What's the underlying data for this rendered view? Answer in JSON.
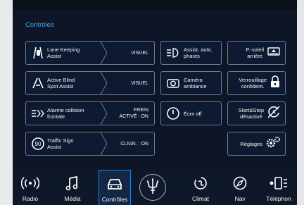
{
  "section": {
    "title": "Contrôles"
  },
  "left_tiles": [
    {
      "label": "Lane Keeping\nAssist",
      "value": "VISUEL",
      "icon": "lane-keeping-icon"
    },
    {
      "label": "Active Blind\nSpot Assist",
      "value": "VISUEL",
      "icon": "blind-spot-icon"
    },
    {
      "label": "Alarme collision\nfrontale",
      "value": "FREIN\nACTIVÉ : ON",
      "icon": "collision-alarm-icon"
    },
    {
      "label": "Traffic Sign\nAssist",
      "value": "CLIGN. : ON",
      "icon": "traffic-sign-icon"
    }
  ],
  "mid_tiles": [
    {
      "label": "Assist. auto.\nphares",
      "icon": "auto-headlight-icon"
    },
    {
      "label": "Caméra\nambiance",
      "icon": "camera-icon"
    },
    {
      "label": "Écrn off",
      "icon": "power-icon"
    }
  ],
  "right_tiles": [
    {
      "label": "P.-soleil\narrière",
      "icon": "sunshade-icon"
    },
    {
      "label": "Verrouillage\nconfident.",
      "icon": "lock-icon"
    },
    {
      "label": "Start&Stop\ndésactivé",
      "icon": "start-stop-icon"
    },
    {
      "label": "Réglages",
      "icon": "gears-icon"
    }
  ],
  "nav": [
    {
      "label": "Radio",
      "icon": "radio-icon"
    },
    {
      "label": "Média",
      "icon": "music-icon"
    },
    {
      "label": "Contrôles",
      "icon": "car-icon",
      "active": true
    },
    {
      "label": "",
      "icon": "trident-logo-icon"
    },
    {
      "label": "Climat",
      "icon": "climate-icon"
    },
    {
      "label": "Nav",
      "icon": "compass-icon"
    },
    {
      "label": "Téléphon",
      "icon": "phone-icon"
    }
  ],
  "colors": {
    "accent": "#4ea3e3",
    "background": "#0d1526",
    "tile_border": "#6f7b92"
  }
}
